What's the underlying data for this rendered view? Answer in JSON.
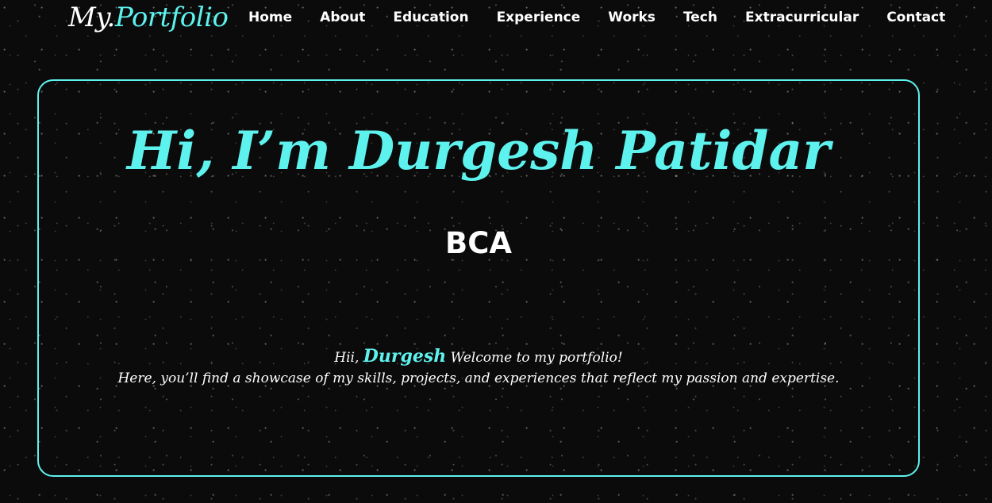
{
  "header": {
    "logo_main": "My.",
    "logo_accent": "Portfolio",
    "nav": [
      {
        "label": "Home"
      },
      {
        "label": "About"
      },
      {
        "label": "Education"
      },
      {
        "label": "Experience"
      },
      {
        "label": "Works"
      },
      {
        "label": "Tech"
      },
      {
        "label": "Extracurricular"
      },
      {
        "label": "Contact"
      }
    ]
  },
  "hero": {
    "title": "Hi, I’m Durgesh Patidar",
    "subtitle": "BCA",
    "intro_prefix": "Hii,",
    "intro_name": "Durgesh",
    "intro_suffix": "Welcome to my portfolio!",
    "intro_line2": "Here, you’ll find a showcase of my skills, projects, and experiences that reflect my passion and expertise."
  },
  "colors": {
    "background": "#0b0b0b",
    "accent": "#5ef2ee",
    "text": "#ffffff"
  }
}
